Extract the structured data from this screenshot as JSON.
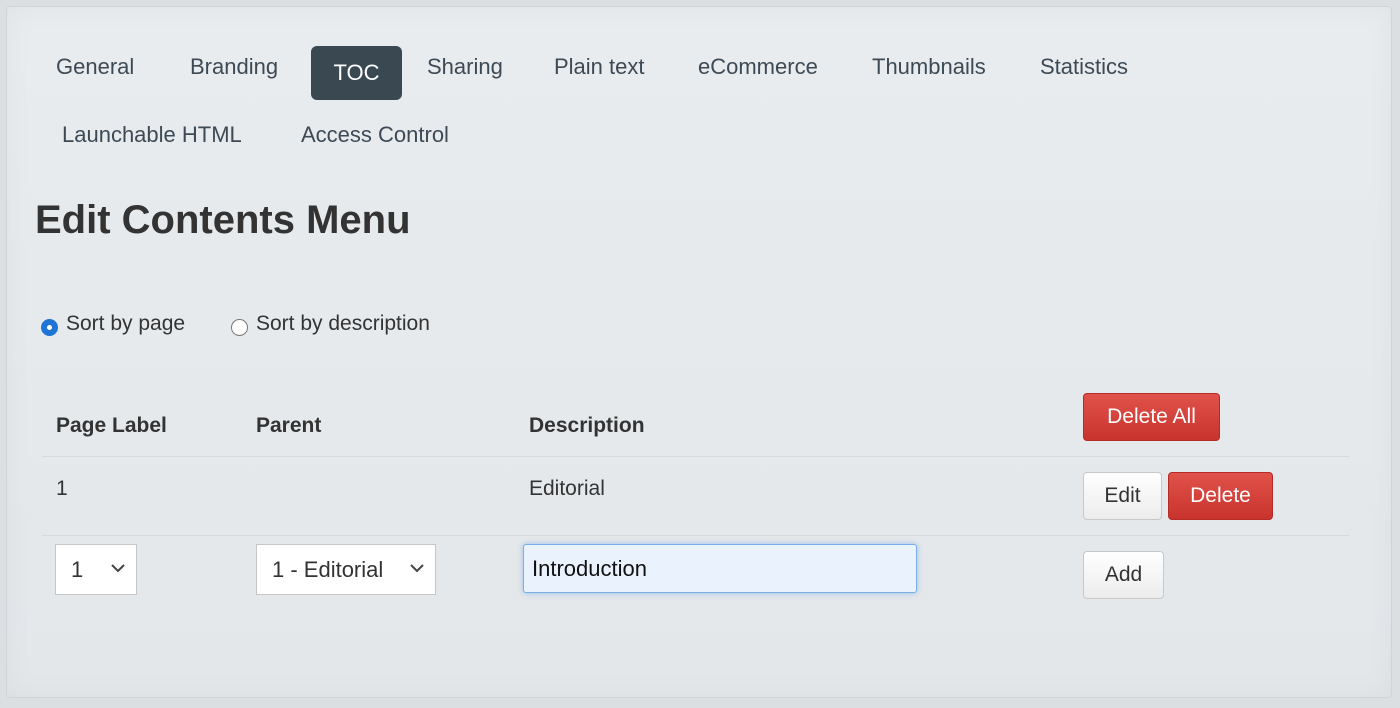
{
  "tabs": [
    {
      "label": "General"
    },
    {
      "label": "Branding"
    },
    {
      "label": "TOC"
    },
    {
      "label": "Sharing"
    },
    {
      "label": "Plain text"
    },
    {
      "label": "eCommerce"
    },
    {
      "label": "Thumbnails"
    },
    {
      "label": "Statistics"
    },
    {
      "label": "Launchable HTML"
    },
    {
      "label": "Access Control"
    }
  ],
  "active_tab": "TOC",
  "page_title": "Edit Contents Menu",
  "sort": {
    "by_page_label": "Sort by page",
    "by_description_label": "Sort by description",
    "selected": "Sort by page"
  },
  "table": {
    "headers": {
      "page_label": "Page Label",
      "parent": "Parent",
      "description": "Description"
    },
    "delete_all_label": "Delete All",
    "rows": [
      {
        "page_label": "1",
        "parent": "",
        "description": "Editorial",
        "edit_label": "Edit",
        "delete_label": "Delete"
      }
    ],
    "new_entry": {
      "page_value": "1",
      "parent_value": "1 - Editorial",
      "description_value": "Introduction",
      "add_label": "Add"
    }
  },
  "colors": {
    "active_tab_bg": "#3a4852",
    "danger": "#d0403a",
    "radio_checked": "#1f75d6",
    "input_focus_border": "#79aee8"
  }
}
